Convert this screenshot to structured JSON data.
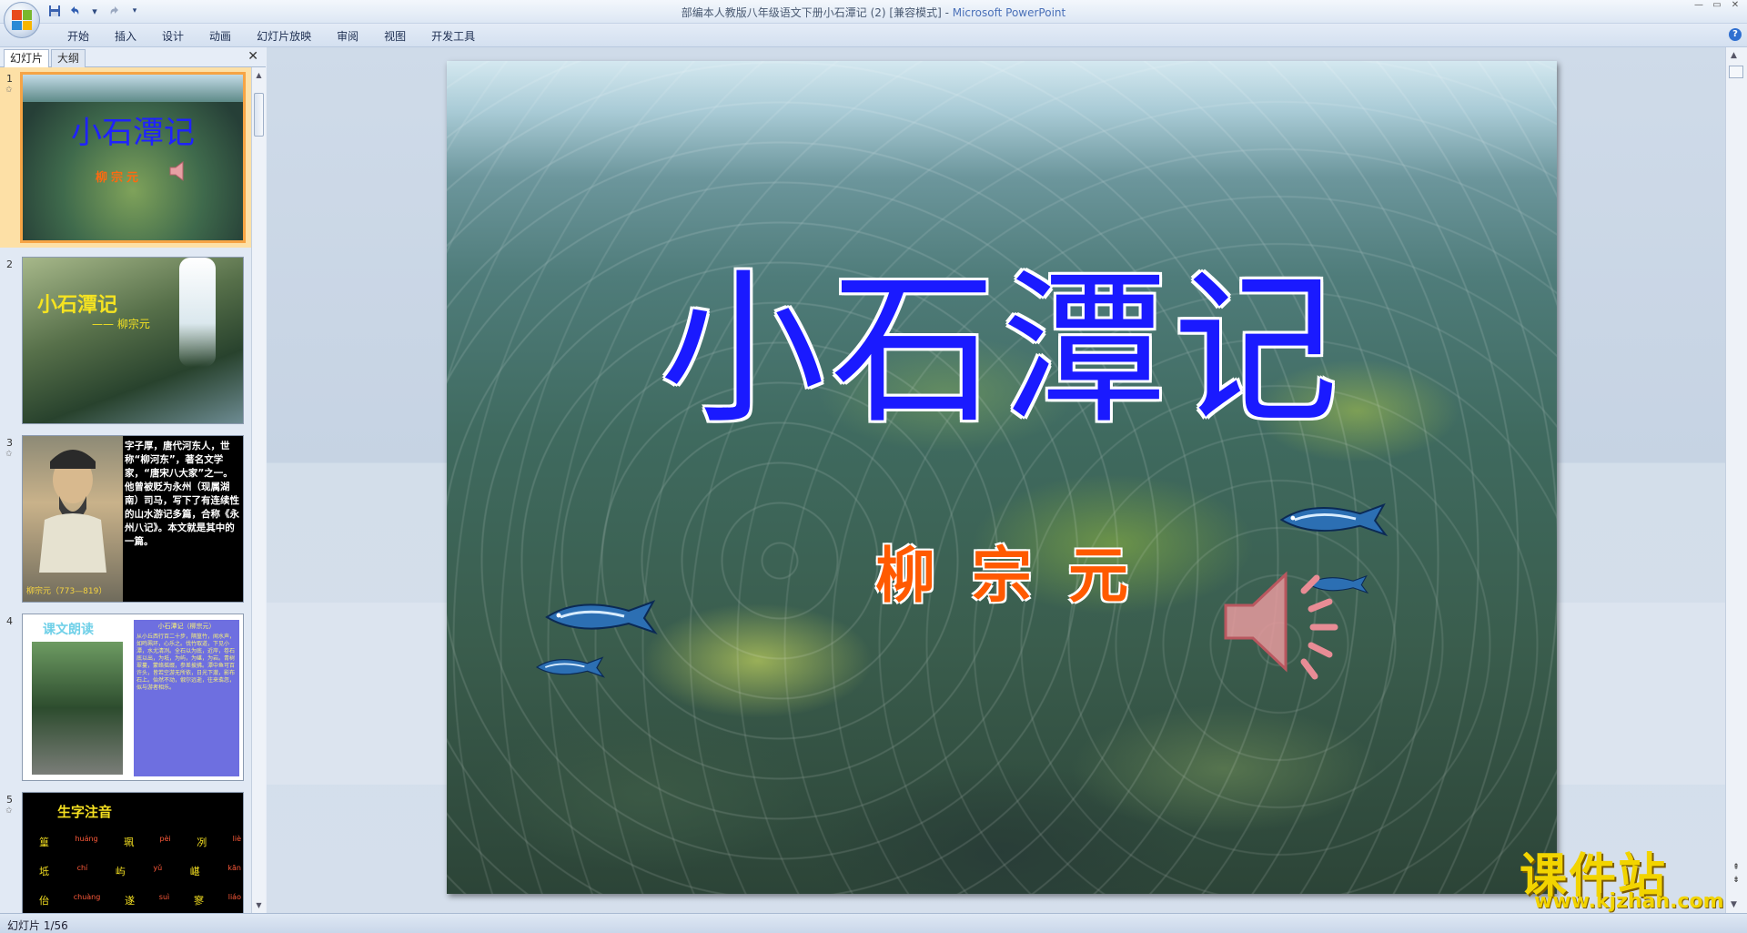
{
  "window": {
    "title": "部编本人教版八年级语文下册小石潭记 (2) [兼容模式] - ",
    "app_name": "Microsoft PowerPoint"
  },
  "qat": {
    "save_icon": "save-icon",
    "undo_icon": "undo-icon",
    "redo_icon": "redo-icon"
  },
  "ribbon": {
    "tabs": [
      "开始",
      "插入",
      "设计",
      "动画",
      "幻灯片放映",
      "审阅",
      "视图",
      "开发工具"
    ],
    "help": "?"
  },
  "panel": {
    "tab_slides": "幻灯片",
    "tab_outline": "大纲",
    "close": "✕"
  },
  "thumbnails": [
    {
      "num": "1",
      "title": "小石潭记",
      "author": "柳宗元"
    },
    {
      "num": "2",
      "title": "小石潭记",
      "author": "—— 柳宗元"
    },
    {
      "num": "3",
      "caption": "柳宗元（773—819）",
      "bio": "字子厚，唐代河东人，世称“柳河东”，著名文学家，“唐宋八大家”之一。他曾被贬为永州（现属湖南）司马，写下了有连续性的山水游记多篇，合称《永州八记》。本文就是其中的一篇。"
    },
    {
      "num": "4",
      "label": "课文朗读",
      "text_title": "小石潭记（柳宗元）",
      "text": "从小丘西行百二十步，隔篁竹，闻水声，如鸣珮环，心乐之。伐竹取道，下见小潭，水尤清冽。全石以为底，近岸，卷石底以出，为坻，为屿，为嵁，为岩。青树翠蔓，蒙络摇缀，参差披拂。潭中鱼可百许头，皆若空游无所依，日光下澈，影布石上。佁然不动，俶尔远逝，往来翕忽，似与游者相乐。"
    },
    {
      "num": "5",
      "label": "生字注音",
      "rows": [
        [
          "篁",
          "huáng",
          "珮",
          "pèi",
          "冽",
          "liè"
        ],
        [
          "坻",
          "chí",
          "屿",
          "yǔ",
          "嵁",
          "kān"
        ],
        [
          "佁",
          "chuàng",
          "遂",
          "suì",
          "寥",
          "liáo"
        ]
      ]
    }
  ],
  "slide": {
    "title": "小石潭记",
    "author": "柳宗元"
  },
  "status": {
    "slide_counter": "幻灯片 1/56"
  },
  "watermark": {
    "brand": "课件站",
    "url": "www.kjzhan.com"
  },
  "colors": {
    "title_blue": "#1a1aff",
    "author_orange": "#ff5a00",
    "selection_orange": "#f6a445",
    "watermark_yellow": "#f2d400"
  }
}
